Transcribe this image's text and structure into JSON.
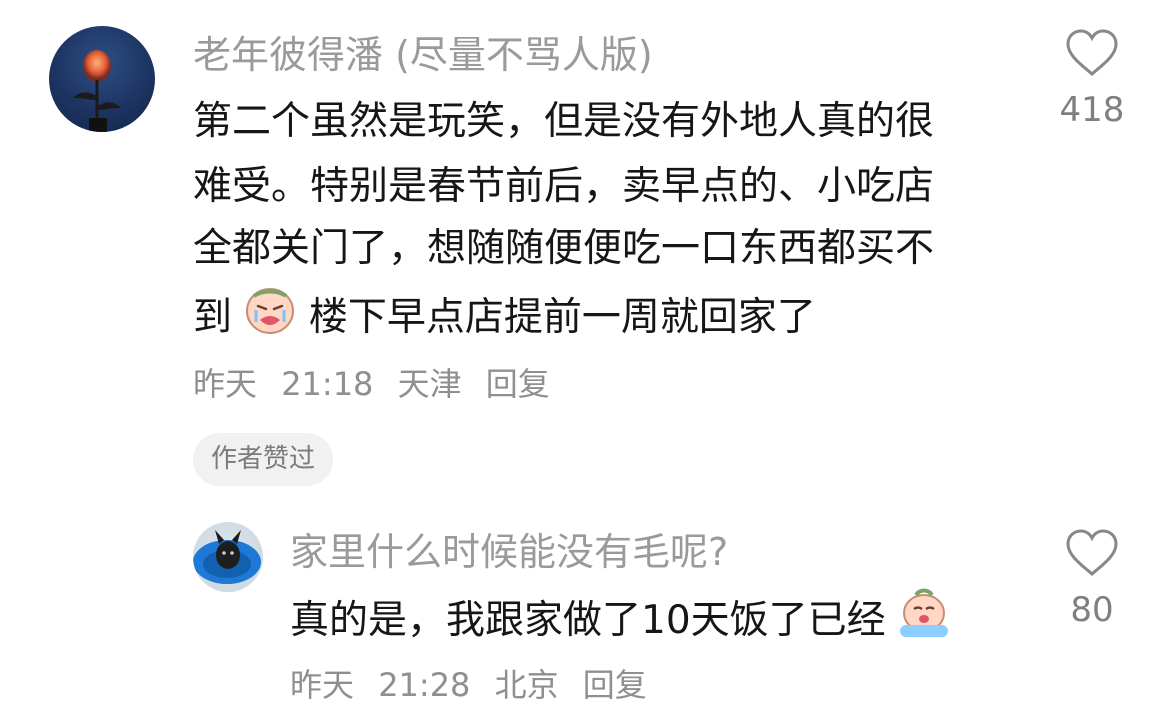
{
  "comments": [
    {
      "username": "老年彼得潘 (尽量不骂人版)",
      "lines": [
        "第二个虽然是玩笑，但是没有外地人真的很",
        "难受。特别是春节前后，卖早点的、小吃店",
        "全都关门了，想随随便便吃一口东西都买不",
        "到"
      ],
      "last_line_after_emoji": "楼下早点店提前一周就回家了",
      "emoji": "crying-face-emoji",
      "date": "昨天",
      "time": "21:18",
      "location": "天津",
      "reply_label": "回复",
      "like_count": "418",
      "author_liked_label": "作者赞过"
    },
    {
      "username": "家里什么时候能没有毛呢?",
      "text": "真的是，我跟家做了10天饭了已经",
      "emoji": "sobbing-face-emoji",
      "date": "昨天",
      "time": "21:28",
      "location": "北京",
      "reply_label": "回复",
      "like_count": "80"
    }
  ],
  "icons": {
    "like": "heart-outline-icon"
  }
}
